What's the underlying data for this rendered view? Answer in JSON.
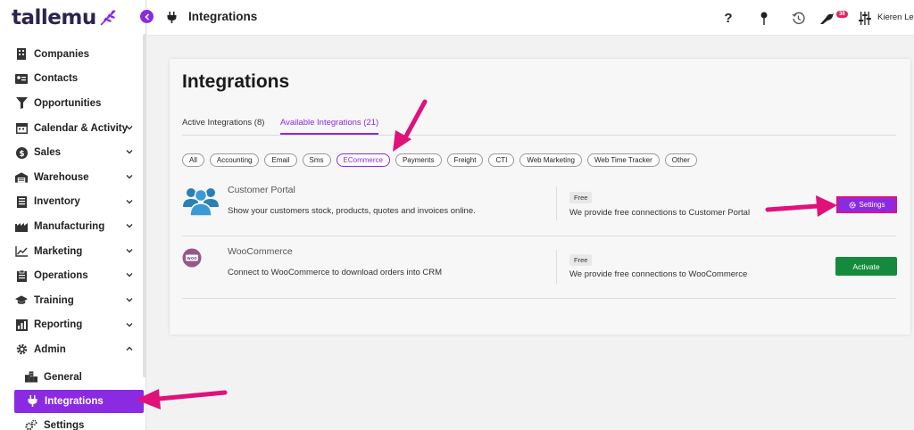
{
  "brand": {
    "name": "tallemu",
    "accent": "#8a2be2",
    "annotation": "#e0117a"
  },
  "sidebar": {
    "items": [
      {
        "label": "Companies",
        "icon": "building-icon",
        "expandable": false
      },
      {
        "label": "Contacts",
        "icon": "contact-card-icon",
        "expandable": false
      },
      {
        "label": "Opportunities",
        "icon": "funnel-icon",
        "expandable": false
      },
      {
        "label": "Calendar & Activity",
        "icon": "calendar-icon",
        "expandable": true
      },
      {
        "label": "Sales",
        "icon": "dollar-icon",
        "expandable": true
      },
      {
        "label": "Warehouse",
        "icon": "warehouse-icon",
        "expandable": true
      },
      {
        "label": "Inventory",
        "icon": "inventory-icon",
        "expandable": true
      },
      {
        "label": "Manufacturing",
        "icon": "factory-icon",
        "expandable": true
      },
      {
        "label": "Marketing",
        "icon": "chart-line-icon",
        "expandable": true
      },
      {
        "label": "Operations",
        "icon": "clipboard-icon",
        "expandable": true
      },
      {
        "label": "Training",
        "icon": "graduation-cap-icon",
        "expandable": true
      },
      {
        "label": "Reporting",
        "icon": "report-icon",
        "expandable": true
      },
      {
        "label": "Admin",
        "icon": "gear-icon",
        "expandable": true,
        "expanded": true
      }
    ],
    "admin_sub": [
      {
        "label": "General",
        "icon": "city-icon"
      },
      {
        "label": "Integrations",
        "icon": "plug-icon",
        "active": true
      },
      {
        "label": "Settings",
        "icon": "cogs-icon"
      }
    ]
  },
  "topbar": {
    "title": "Integrations",
    "help": "?",
    "notification_count": "38",
    "user": "Kieren Le C"
  },
  "main": {
    "title": "Integrations",
    "tabs": [
      {
        "label": "Active Integrations (8)"
      },
      {
        "label": "Available Integrations (21)",
        "active": true
      }
    ],
    "filters": [
      "All",
      "Accounting",
      "Email",
      "Sms",
      "ECommerce",
      "Payments",
      "Freight",
      "CTI",
      "Web Marketing",
      "Web Time Tracker",
      "Other"
    ],
    "active_filter": "ECommerce",
    "integrations": [
      {
        "name": "Customer Portal",
        "description": "Show your customers stock, products, quotes and invoices online.",
        "price": "Free",
        "price_desc": "We provide free connections to Customer Portal",
        "action": "Settings",
        "icon": "users-icon"
      },
      {
        "name": "WooCommerce",
        "description": "Connect to WooCommerce to download orders into CRM",
        "price": "Free",
        "price_desc": "We provide free connections to WooCommerce",
        "action": "Activate",
        "icon_text": "woo"
      }
    ]
  }
}
